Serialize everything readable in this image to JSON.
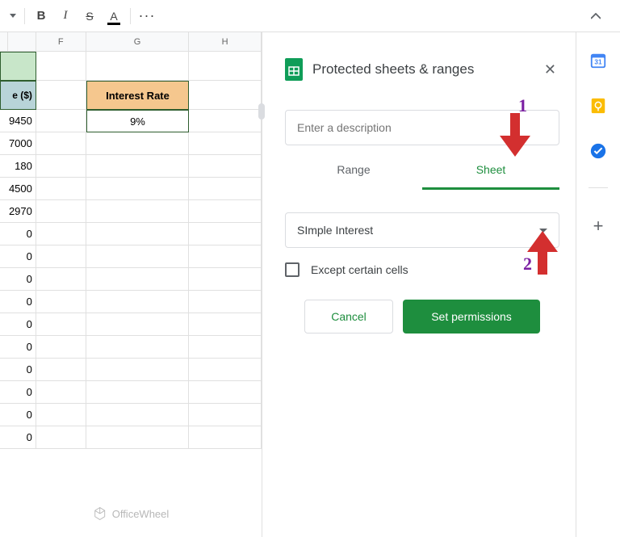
{
  "toolbar": {
    "bold": "B",
    "italic": "I",
    "strike": "S",
    "textcolor": "A",
    "more": "···"
  },
  "columns": {
    "e": "",
    "f": "F",
    "g": "G",
    "h": "H"
  },
  "sheet": {
    "row2_e_header": "e ($)",
    "interest_rate_label": "Interest Rate",
    "interest_rate_value": "9%",
    "vals": [
      "9450",
      "7000",
      "180",
      "4500",
      "2970",
      "0",
      "0",
      "0",
      "0",
      "0",
      "0",
      "0",
      "0",
      "0",
      "0"
    ]
  },
  "panel": {
    "title": "Protected sheets & ranges",
    "description_placeholder": "Enter a description",
    "tab_range": "Range",
    "tab_sheet": "Sheet",
    "sheet_selected": "SImple Interest",
    "except_label": "Except certain cells",
    "cancel": "Cancel",
    "set_permissions": "Set permissions"
  },
  "annotations": {
    "one": "1",
    "two": "2"
  },
  "watermark": "OfficeWheel"
}
